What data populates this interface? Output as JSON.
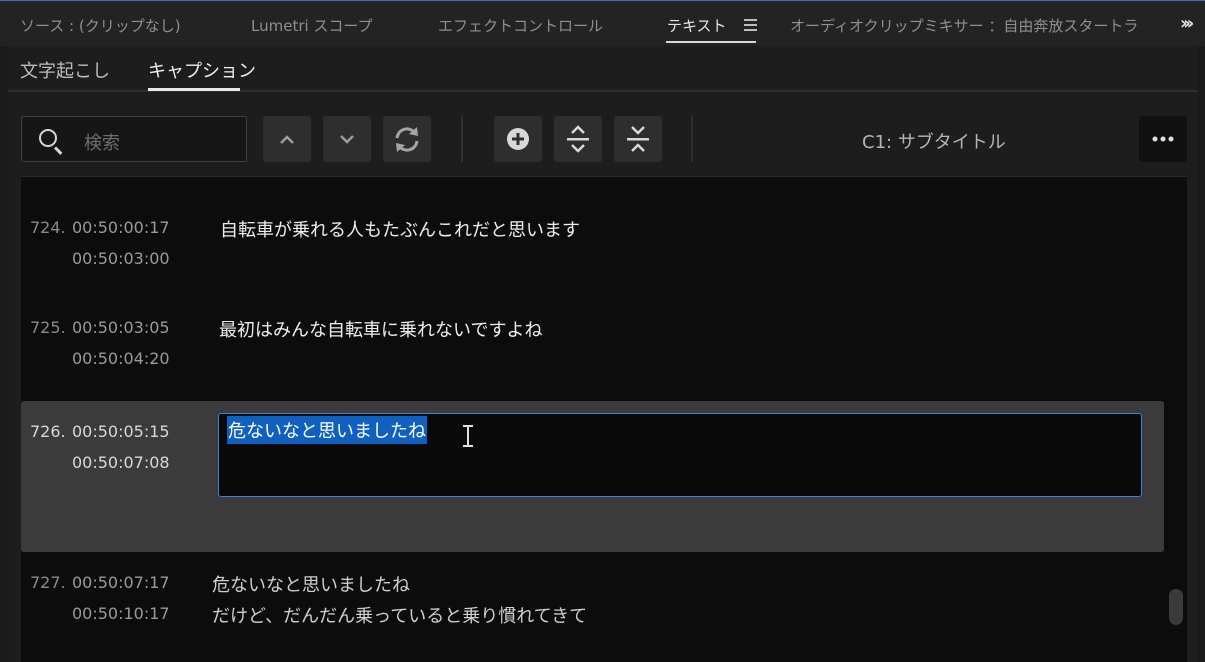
{
  "panel_tabs": [
    {
      "label": "ソース : (クリップなし)"
    },
    {
      "label": "Lumetri スコープ"
    },
    {
      "label": "エフェクトコントロール"
    },
    {
      "label": "テキスト"
    },
    {
      "label": "オーディオクリップミキサー ：自由奔放スタートラ"
    }
  ],
  "sub_tabs": [
    "文字起こし",
    "キャプション"
  ],
  "search": {
    "placeholder": "検索"
  },
  "toolbar": {
    "prev_icon": "chevron-up-icon",
    "next_icon": "chevron-down-icon",
    "replace_icon": "refresh-icon",
    "add_icon": "plus-circle-icon",
    "split_icon": "split-icon",
    "merge_icon": "merge-icon",
    "more_icon": "more-icon",
    "track_label": "C1: サブタイトル"
  },
  "captions": [
    {
      "num": "724.",
      "in": "00:50:00:17",
      "out": "00:50:03:00",
      "text": "自転車が乗れる人もたぶんこれだと思います"
    },
    {
      "num": "725.",
      "in": "00:50:03:05",
      "out": "00:50:04:20",
      "text": "最初はみんな自転車に乗れないですよね"
    },
    {
      "num": "726.",
      "in": "00:50:05:15",
      "out": "00:50:07:08",
      "text": "危ないなと思いましたね",
      "selected": true
    },
    {
      "num": "727.",
      "in": "00:50:07:17",
      "out": "00:50:10:17",
      "text": "危ないなと思いましたね",
      "text2": "だけど、だんだん乗っていると乗り慣れてきて"
    }
  ],
  "colors": {
    "accent": "#3a82e0",
    "selection": "#1060c0"
  }
}
